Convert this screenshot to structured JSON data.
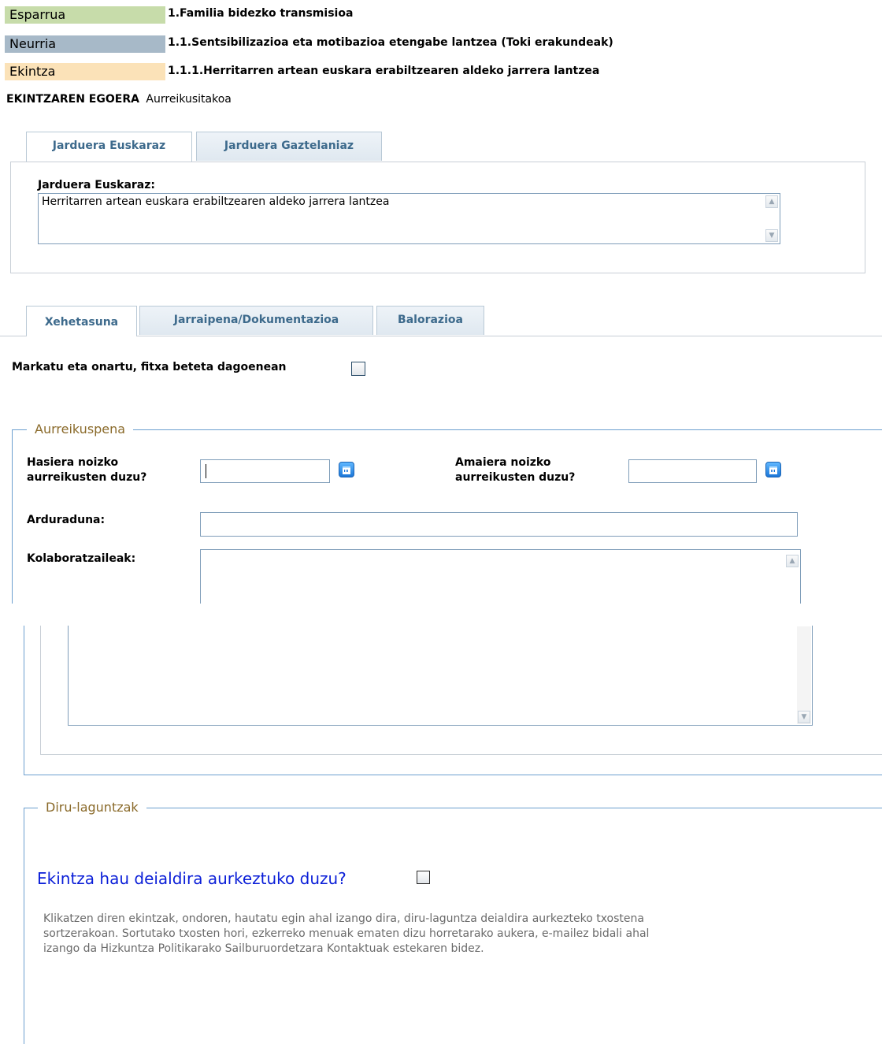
{
  "header": {
    "rows": [
      {
        "label": "Esparrua",
        "value": "1.Familia bidezko transmisioa",
        "color": "#c7dcaa"
      },
      {
        "label": "Neurria",
        "value": "1.1.Sentsibilizazioa eta motibazioa etengabe lantzea (Toki erakundeak)",
        "color": "#a7b9c8"
      },
      {
        "label": "Ekintza",
        "value": "1.1.1.Herritarren artean euskara erabiltzearen aldeko jarrera lantzea",
        "color": "#fbe2b8"
      }
    ],
    "status_label": "EKINTZAREN EGOERA",
    "status_value": "Aurreikusitakoa"
  },
  "activity_tabs": {
    "tabs": [
      "Jarduera Euskaraz",
      "Jarduera Gaztelaniaz"
    ],
    "active": 0,
    "field_label": "Jarduera Euskaraz:",
    "field_value": "Herritarren artean euskara erabiltzearen aldeko jarrera lantzea"
  },
  "detail_tabs": {
    "tabs": [
      "Xehetasuna",
      "Jarraipena/Dokumentazioa",
      "Balorazioa"
    ],
    "active": 0
  },
  "approve_checkbox": {
    "label": "Markatu eta onartu, fitxa beteta dagoenean",
    "checked": false
  },
  "forecast": {
    "legend": "Aurreikuspena",
    "start_label": "Hasiera noizko aurreikusten duzu?",
    "start_value": "",
    "end_label": "Amaiera noizko aurreikusten duzu?",
    "end_value": "",
    "responsible_label": "Arduraduna:",
    "responsible_value": "",
    "collaborators_label": "Kolaboratzaileak:",
    "collaborators_value": ""
  },
  "subsidies": {
    "legend": "Diru-laguntzak",
    "question": "Ekintza hau deialdira aurkeztuko duzu?",
    "checked": false,
    "help_text": "Klikatzen diren ekintzak, ondoren, hautatu egin ahal izango dira, diru-laguntza deialdira aurkezteko txostena sortzerakoan. Sortutako txosten hori, ezkerreko menuak ematen dizu horretarako aukera, e-mailez bidali ahal izango da Hizkuntza Politikarako Sailburuordetzara Kontaktuak estekaren bidez."
  },
  "colors": {
    "accent_blue": "#0a1ed8",
    "legend_brown": "#8a6a2a",
    "tab_text": "#3d6a8c",
    "fieldset_border": "#6c9fcf"
  }
}
